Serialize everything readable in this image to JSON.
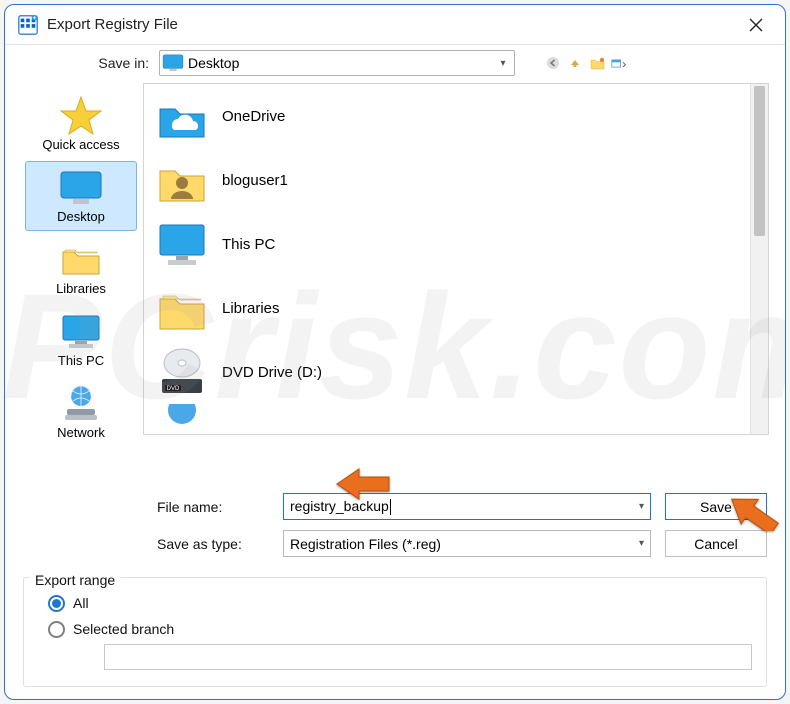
{
  "window": {
    "title": "Export Registry File"
  },
  "savein": {
    "label": "Save in:",
    "value": "Desktop"
  },
  "places": [
    {
      "key": "quick",
      "label": "Quick access"
    },
    {
      "key": "desktop",
      "label": "Desktop"
    },
    {
      "key": "libs",
      "label": "Libraries"
    },
    {
      "key": "pc",
      "label": "This PC"
    },
    {
      "key": "net",
      "label": "Network"
    }
  ],
  "items": [
    {
      "label": "OneDrive",
      "icon": "onedrive"
    },
    {
      "label": "bloguser1",
      "icon": "userfolder"
    },
    {
      "label": "This PC",
      "icon": "monitor"
    },
    {
      "label": "Libraries",
      "icon": "folder"
    },
    {
      "label": "DVD Drive (D:)",
      "icon": "dvd"
    }
  ],
  "form": {
    "filename_label": "File name:",
    "filename_value": "registry_backup",
    "type_label": "Save as type:",
    "type_value": "Registration Files (*.reg)",
    "save_label": "Save",
    "cancel_label": "Cancel"
  },
  "export": {
    "group": "Export range",
    "all_label": "All",
    "branch_label": "Selected branch"
  },
  "watermark": "PCrisk.com"
}
